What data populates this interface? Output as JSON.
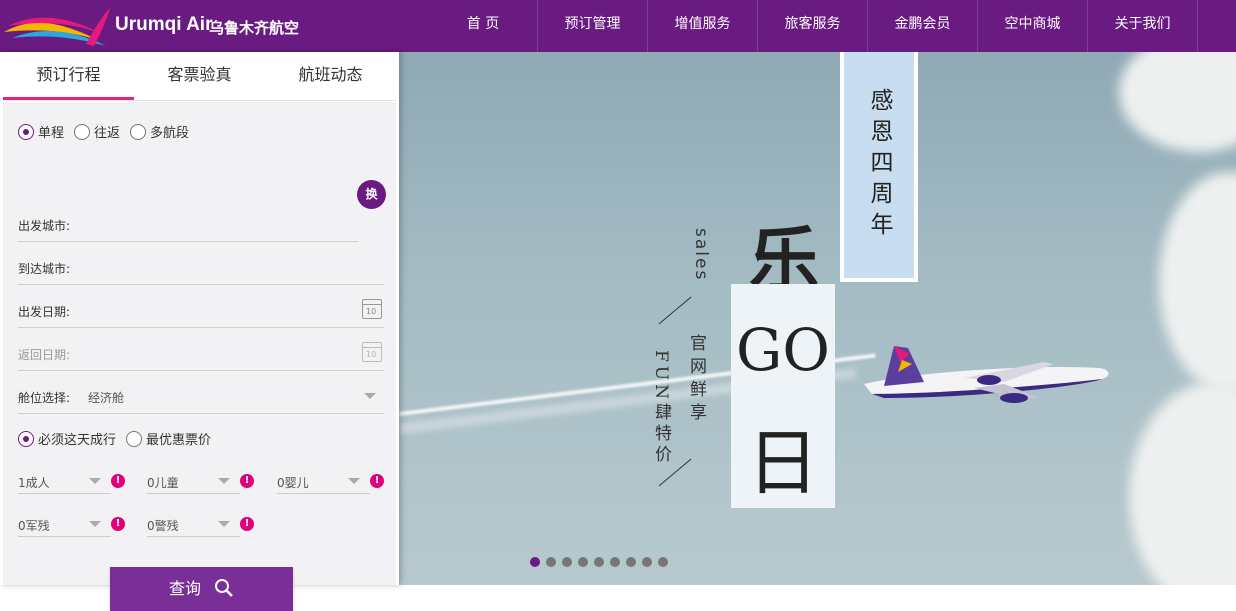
{
  "brand": {
    "name_en": "Urumqi Air",
    "name_cn": "乌鲁木齐航空"
  },
  "nav": [
    "首 页",
    "预订管理",
    "增值服务",
    "旅客服务",
    "金鹏会员",
    "空中商城",
    "关于我们"
  ],
  "tabs": [
    "预订行程",
    "客票验真",
    "航班动态"
  ],
  "trip_type": {
    "options": [
      "单程",
      "往返",
      "多航段"
    ],
    "selected": "单程"
  },
  "fields": {
    "from": "出发城市:",
    "to": "到达城市:",
    "depart": "出发日期:",
    "return": "返回日期:",
    "cabin_label": "舱位选择:",
    "cabin_value": "经济舱",
    "calendar_day": "10"
  },
  "swap_label": "换",
  "preference": {
    "options": [
      "必须这天成行",
      "最优惠票价"
    ],
    "selected": "必须这天成行"
  },
  "passengers": {
    "adult": "1成人",
    "child": "0儿童",
    "infant": "0婴儿",
    "military": "0军残",
    "police": "0警残"
  },
  "info_glyph": "!",
  "search_label": "查询",
  "banner": {
    "vertical_title": "感恩四周年",
    "big_le": "乐",
    "big_go": "GO",
    "big_ri": "日",
    "sales": "sales",
    "line1": "官网鲜享",
    "line2": "FUN肆特价"
  },
  "carousel": {
    "count": 9,
    "active": 0
  },
  "colors": {
    "brand": "#6a1b82",
    "accent": "#e0257a",
    "button": "#7a2f98"
  }
}
